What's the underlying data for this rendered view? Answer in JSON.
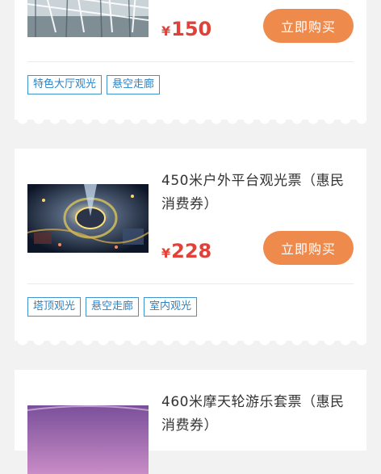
{
  "items": [
    {
      "title": "",
      "currency": "¥",
      "price": "150",
      "buy_label": "立即购买",
      "tags": [
        "特色大厅观光",
        "悬空走廊"
      ]
    },
    {
      "title": "450米户外平台观光票（惠民消费券）",
      "currency": "¥",
      "price": "228",
      "buy_label": "立即购买",
      "tags": [
        "塔顶观光",
        "悬空走廊",
        "室内观光"
      ]
    },
    {
      "title": "460米摩天轮游乐套票（惠民消费券）",
      "currency": "",
      "price": "",
      "buy_label": "",
      "tags": []
    }
  ]
}
